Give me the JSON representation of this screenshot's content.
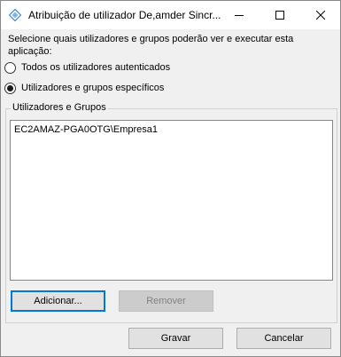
{
  "window": {
    "title": "Atribuição de utilizador De,amder Sincr..."
  },
  "titlebar": {
    "minimize_icon": "minimize-icon",
    "maximize_icon": "maximize-icon",
    "close_icon": "close-icon",
    "app_icon": "app-icon"
  },
  "prompt": "Selecione quais utilizadores e grupos poderão ver e executar esta aplicação:",
  "options": [
    {
      "label": "Todos os utilizadores autenticados",
      "checked": false
    },
    {
      "label": "Utilizadores e grupos específicos",
      "checked": true
    }
  ],
  "group": {
    "legend": "Utilizadores e Grupos",
    "items": [
      "EC2AMAZ-PGA0OTG\\Empresa1"
    ]
  },
  "buttons": {
    "add": "Adicionar...",
    "remove": "Remover",
    "ok": "Gravar",
    "cancel": "Cancelar"
  },
  "colors": {
    "accent": "#0078d7",
    "dialog_bg": "#f0f0f0"
  }
}
